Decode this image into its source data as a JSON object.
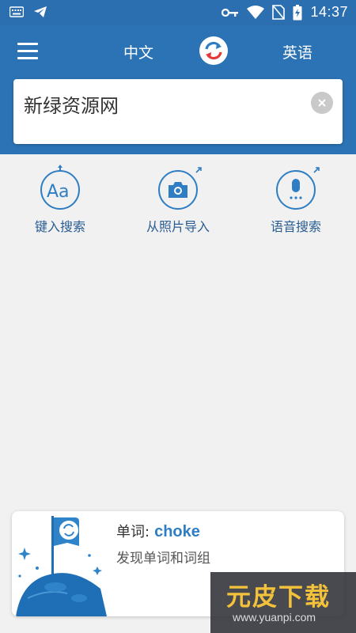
{
  "status_bar": {
    "time": "14:37",
    "icons": [
      "keyboard-icon",
      "telegram-icon",
      "key-icon",
      "wifi-icon",
      "no-sim-icon",
      "battery-charging-icon"
    ]
  },
  "header": {
    "source_lang": "中文",
    "target_lang": "英语",
    "accent_color": "#2b73b5"
  },
  "input": {
    "value": "新绿资源网"
  },
  "actions": [
    {
      "label": "键入搜索",
      "icon": "text-aa-icon"
    },
    {
      "label": "从照片导入",
      "icon": "camera-icon"
    },
    {
      "label": "语音搜索",
      "icon": "microphone-icon"
    }
  ],
  "word_card": {
    "prefix": "单词:",
    "word": "choke",
    "subtitle": "发现单词和词组"
  },
  "watermark": {
    "text": "元皮下载",
    "url": "www.yuanpi.com"
  }
}
